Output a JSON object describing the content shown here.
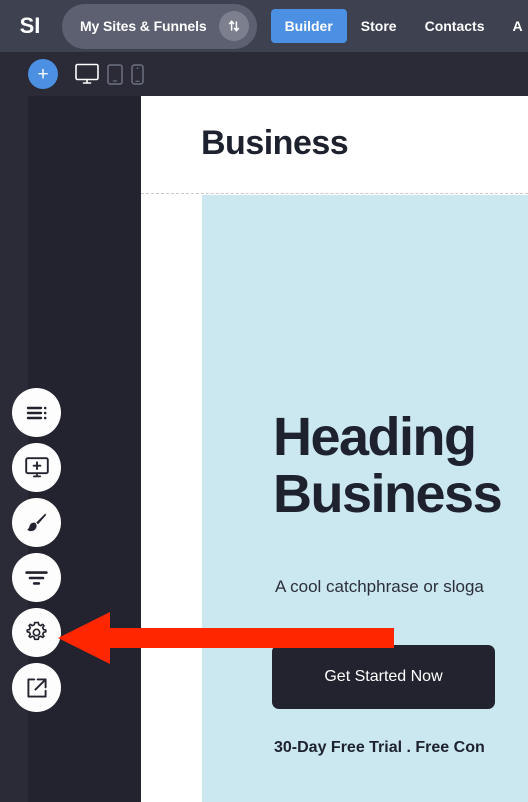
{
  "topbar": {
    "logo": "SI",
    "sites_pill": {
      "label": "My Sites & Funnels",
      "icon": "sort-updown-icon"
    },
    "nav": [
      {
        "label": "Builder",
        "active": true
      },
      {
        "label": "Store",
        "active": false
      },
      {
        "label": "Contacts",
        "active": false
      },
      {
        "label": "A",
        "active": false
      }
    ],
    "colors": {
      "bar": "#3D4150",
      "pill": "#5C6070",
      "active": "#4B90E2"
    }
  },
  "toolbar": {
    "add_label": "+",
    "devices": [
      {
        "name": "desktop",
        "active": true
      },
      {
        "name": "tablet",
        "active": false
      },
      {
        "name": "mobile",
        "active": false
      }
    ]
  },
  "sidebar": {
    "tools": [
      {
        "name": "layers-list-icon"
      },
      {
        "name": "add-section-icon"
      },
      {
        "name": "paint-brush-icon"
      },
      {
        "name": "filter-align-icon"
      },
      {
        "name": "gear-settings-icon"
      },
      {
        "name": "external-link-icon"
      }
    ]
  },
  "canvas": {
    "page_title": "Business",
    "hero": {
      "heading_line1": "Heading",
      "heading_line2": "Business",
      "subheading": "A cool catchphrase or sloga",
      "cta_label": "Get Started Now",
      "footnote": "30-Day Free Trial  .  Free Con",
      "background": "#CBE7F0"
    }
  },
  "annotation": {
    "arrow": {
      "name": "red-pointer-arrow",
      "direction": "left",
      "color": "#FF2600"
    }
  }
}
